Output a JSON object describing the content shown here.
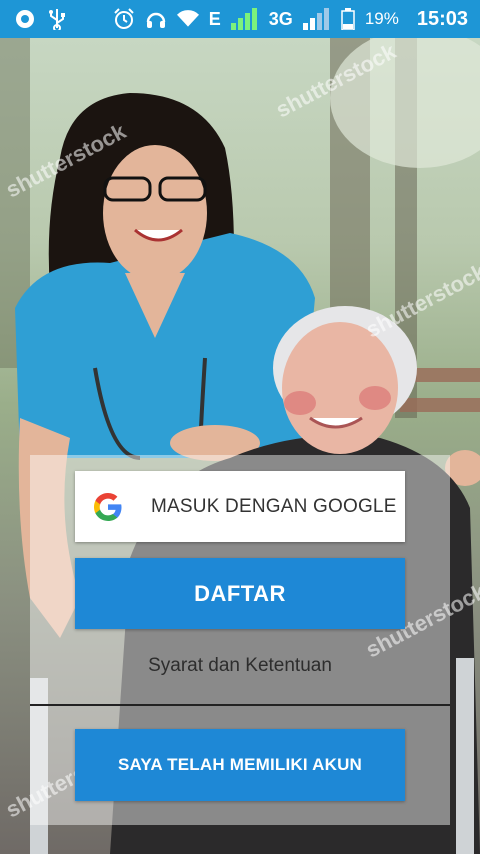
{
  "status_bar": {
    "battery_percent": "19%",
    "network_e": "E",
    "network_3g": "3G",
    "time": "15:03",
    "icons": [
      "record-icon",
      "usb-icon",
      "alarm-icon",
      "headset-icon",
      "wifi-icon",
      "signal-icon",
      "signal-icon",
      "battery-icon"
    ]
  },
  "background": {
    "watermark_text": "shutterstock"
  },
  "actions": {
    "google_label": "MASUK DENGAN GOOGLE",
    "register_label": "DAFTAR",
    "terms_label": "Syarat dan Ketentuan",
    "login_label": "SAYA TELAH MEMILIKI AKUN"
  },
  "colors": {
    "status_bar": "#1e96d6",
    "primary_button": "#1e88d6"
  }
}
